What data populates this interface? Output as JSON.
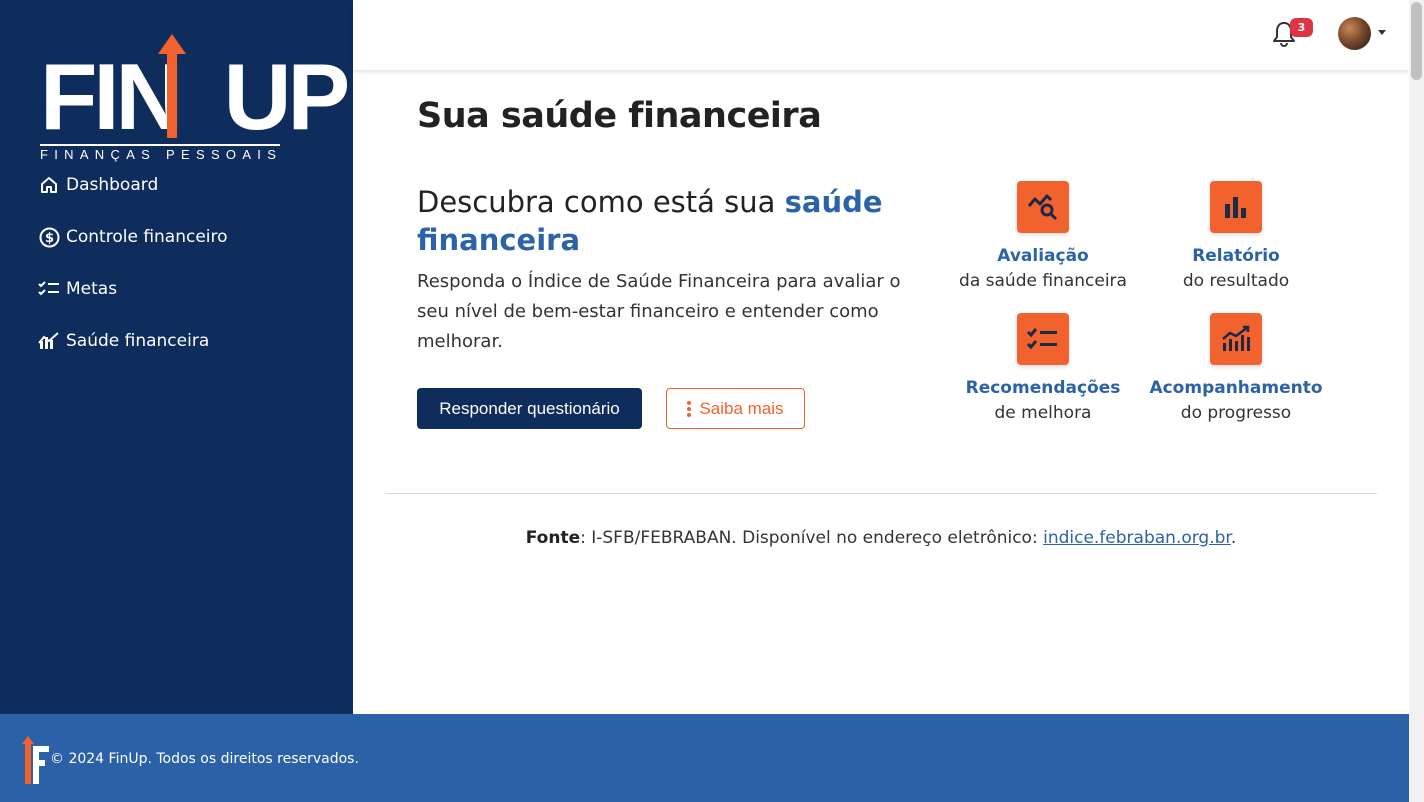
{
  "brand": {
    "name": "FINUP",
    "tagline": "FINANÇAS PESSOAIS",
    "colors": {
      "navy": "#0e2d5c",
      "orange": "#f2622e",
      "blue": "#2b61a7",
      "accent_text": "#2c63a8"
    }
  },
  "sidebar": {
    "items": [
      {
        "label": "Dashboard",
        "icon": "home-icon"
      },
      {
        "label": "Controle financeiro",
        "icon": "dollar-circle-icon"
      },
      {
        "label": "Metas",
        "icon": "checklist-icon"
      },
      {
        "label": "Saúde financeira",
        "icon": "health-chart-icon"
      }
    ]
  },
  "topbar": {
    "notification_count": "3"
  },
  "main": {
    "title": "Sua saúde financeira",
    "headline_prefix": "Descubra como está sua ",
    "headline_accent": "saúde financeira",
    "description": "Responda o Índice de Saúde Financeira para avaliar o seu nível de bem-estar financeiro e entender como melhorar.",
    "primary_button": "Responder questionário",
    "secondary_button": "Saiba mais",
    "features": [
      {
        "title": "Avaliação",
        "subtitle": "da saúde financeira",
        "icon": "chart-search-icon"
      },
      {
        "title": "Relatório",
        "subtitle": "do resultado",
        "icon": "bar-chart-icon"
      },
      {
        "title": "Recomendações",
        "subtitle": "de melhora",
        "icon": "checklist-icon"
      },
      {
        "title": "Acompanhamento",
        "subtitle": "do progresso",
        "icon": "growth-chart-icon"
      }
    ],
    "source": {
      "label": "Fonte",
      "text": ": I-SFB/FEBRABAN. Disponível no endereço eletrônico: ",
      "link": "indice.febraban.org.br",
      "end": "."
    }
  },
  "footer": {
    "copyright": "© 2024 FinUp. Todos os direitos reservados."
  }
}
